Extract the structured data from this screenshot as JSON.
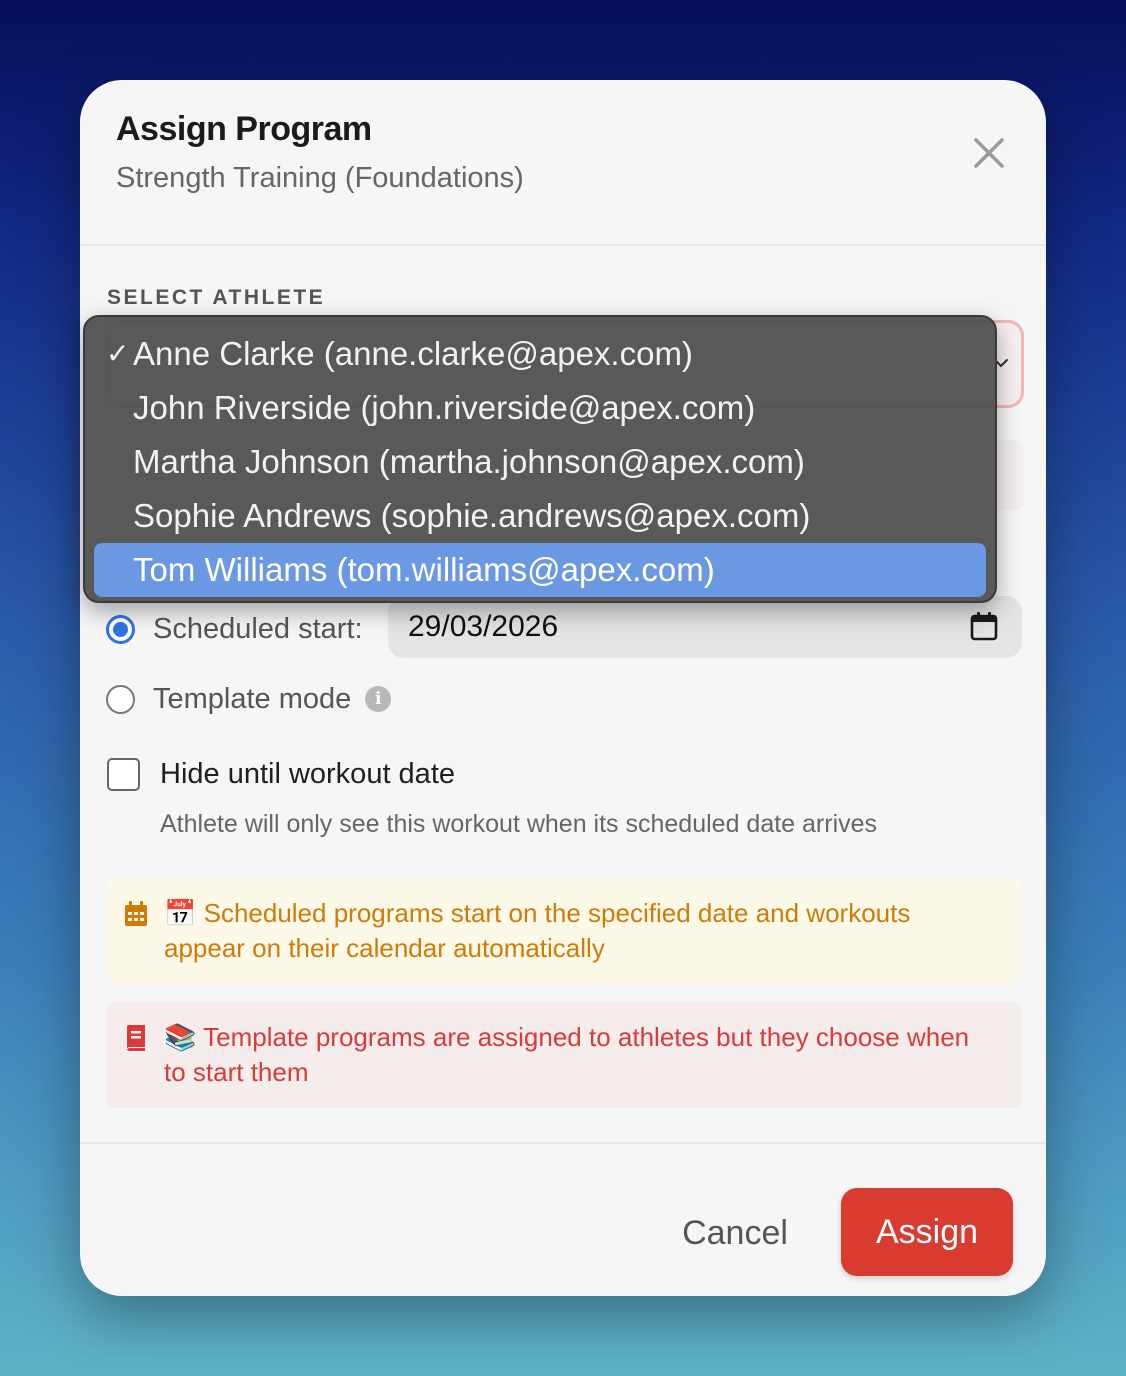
{
  "modal": {
    "title": "Assign Program",
    "subtitle": "Strength Training (Foundations)"
  },
  "athlete_select": {
    "label": "SELECT ATHLETE",
    "selected_index": 0,
    "highlighted_index": 4,
    "options": [
      {
        "label": "Anne Clarke (anne.clarke@apex.com)",
        "checked": true
      },
      {
        "label": "John Riverside (john.riverside@apex.com)",
        "checked": false
      },
      {
        "label": "Martha Johnson (martha.johnson@apex.com)",
        "checked": false
      },
      {
        "label": "Sophie Andrews (sophie.andrews@apex.com)",
        "checked": false
      },
      {
        "label": "Tom Williams (tom.williams@apex.com)",
        "checked": false
      }
    ],
    "check_mark": "✓"
  },
  "mode": {
    "scheduled_label": "Scheduled start:",
    "scheduled_checked": true,
    "date_value": "29/03/2026",
    "template_label": "Template mode",
    "template_checked": false,
    "info_glyph": "i"
  },
  "hide_option": {
    "label": "Hide until workout date",
    "checked": false,
    "help": "Athlete will only see this workout when its scheduled date arrives"
  },
  "notices": {
    "scheduled": "📅 Scheduled programs start on the specified date and workouts appear on their calendar automatically",
    "template": "📚 Template programs are assigned to athletes but they choose when to start them"
  },
  "actions": {
    "cancel": "Cancel",
    "assign": "Assign"
  },
  "colors": {
    "accent_blue": "#2f73e8",
    "assign_red": "#d93b30",
    "notice_yellow": "#d07a08",
    "notice_red": "#d93a3a",
    "dropdown_highlight": "#6b98e2"
  }
}
